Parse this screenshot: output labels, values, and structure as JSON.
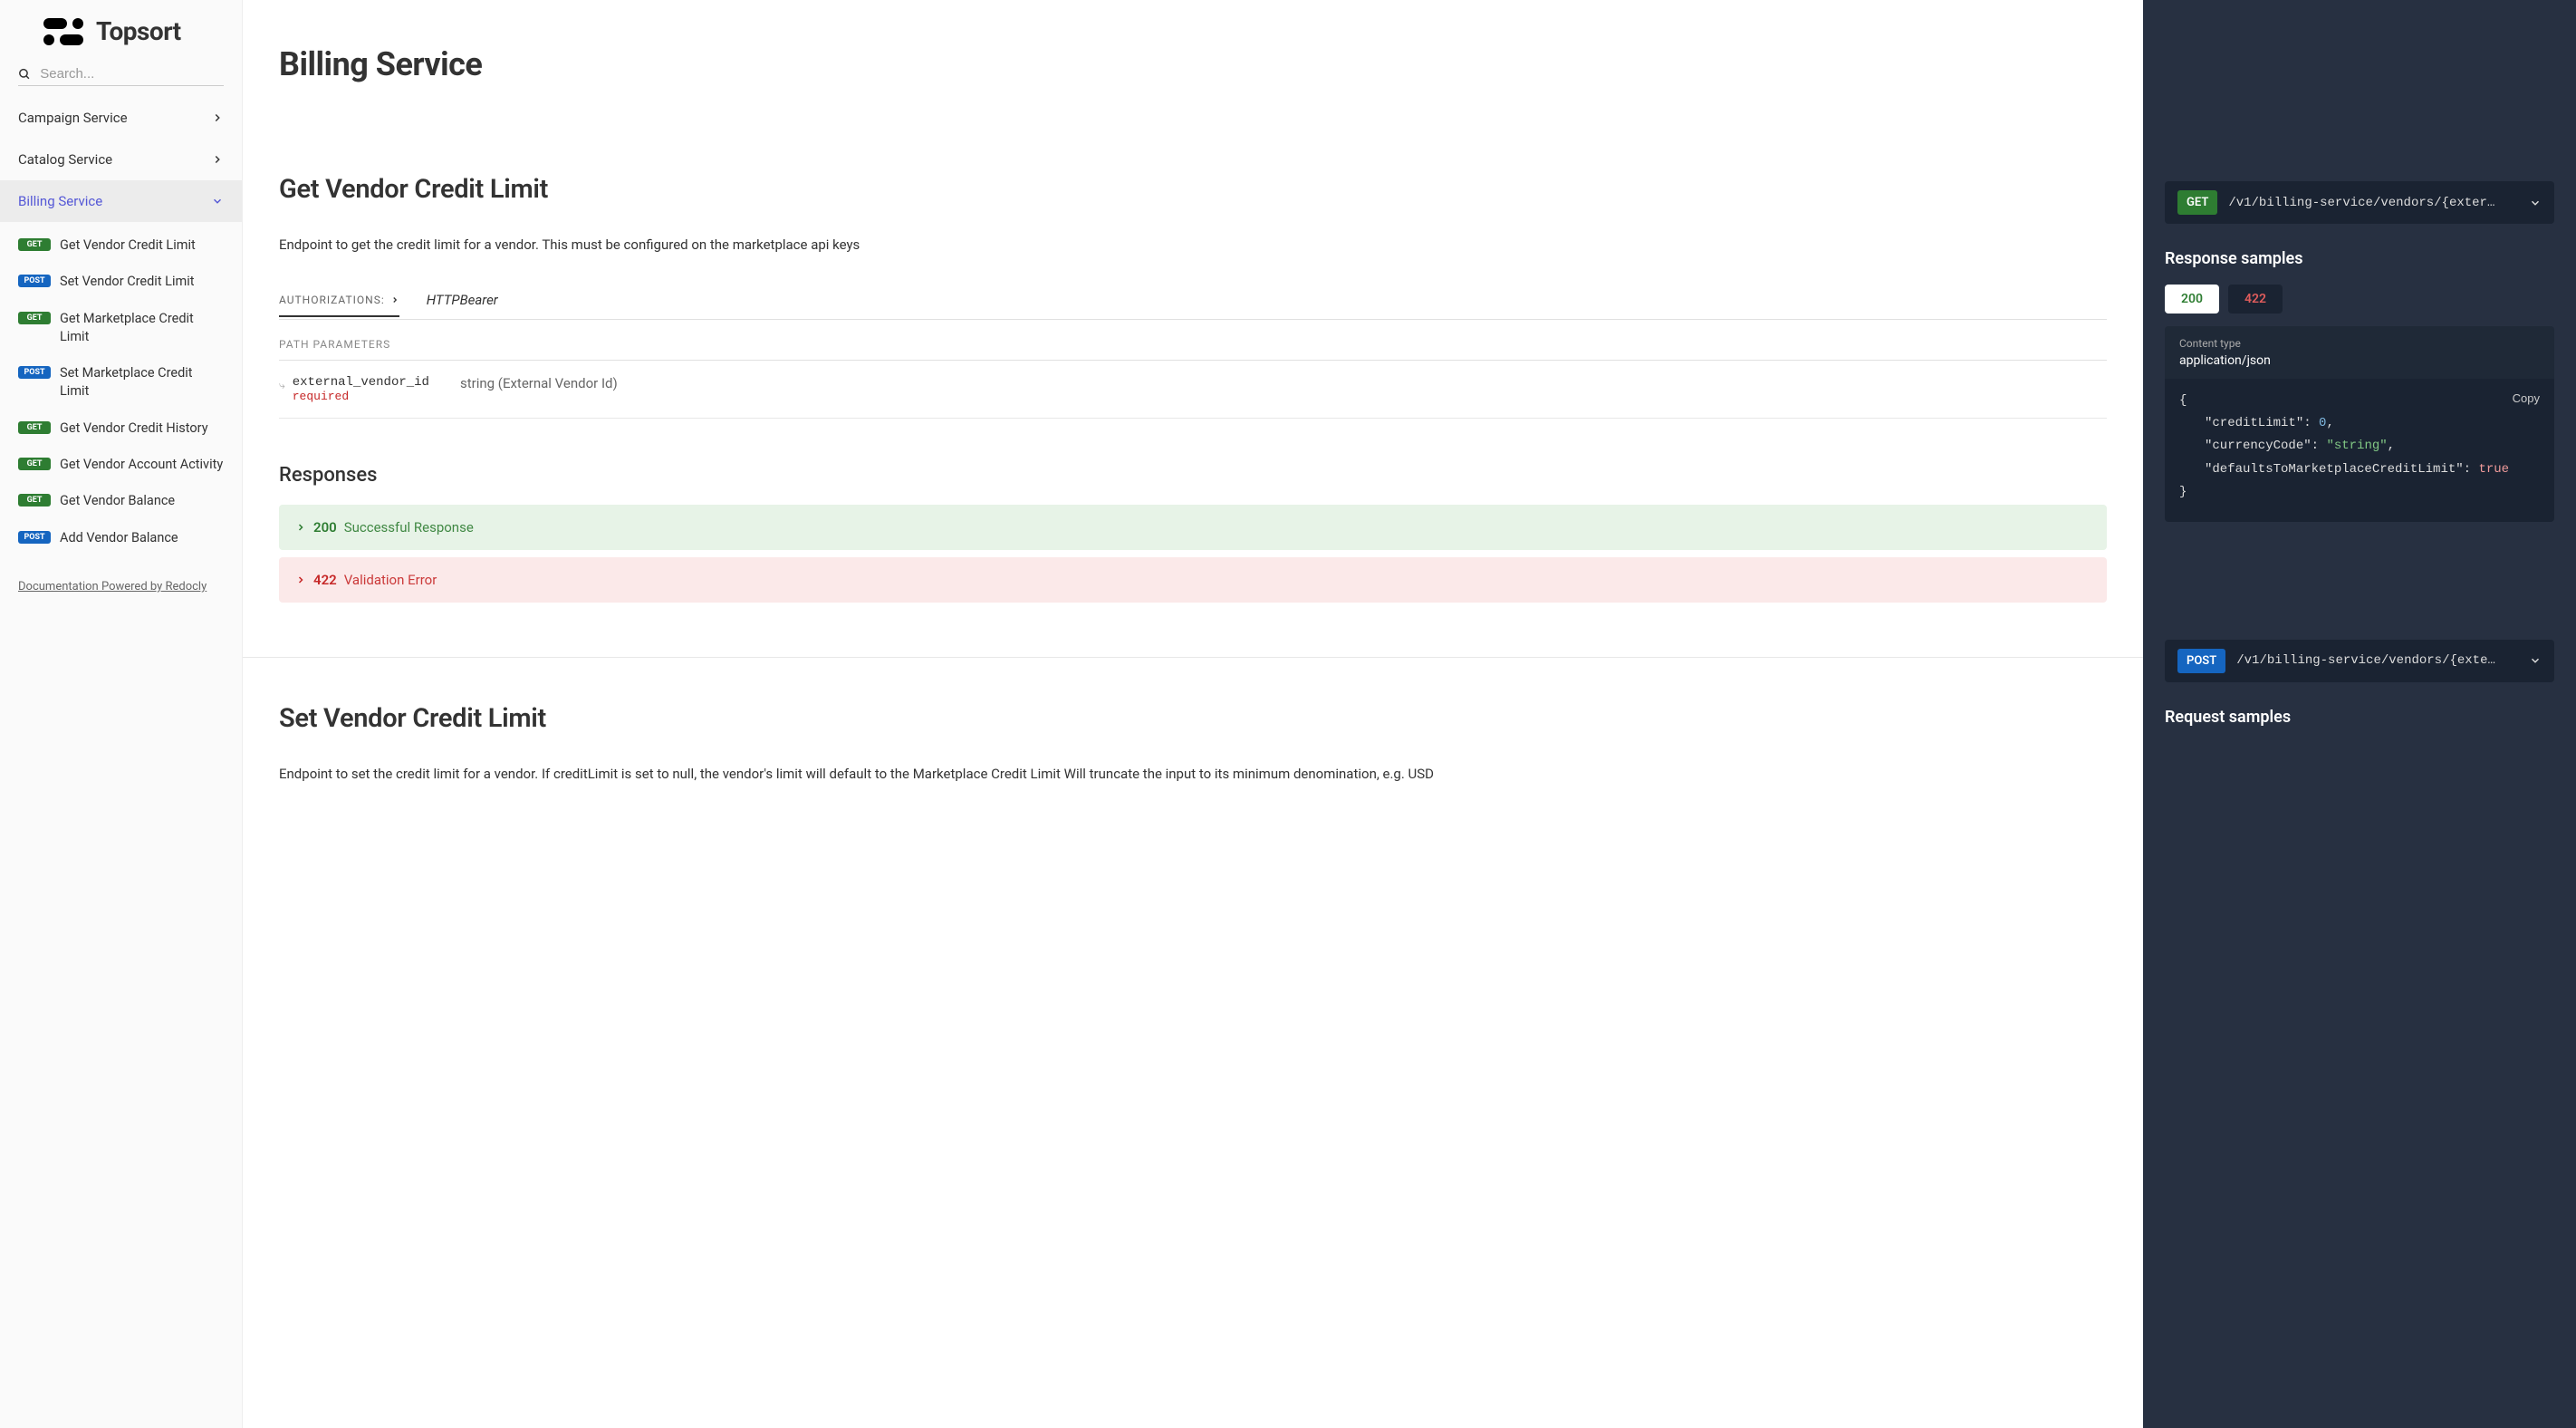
{
  "brand": "Topsort",
  "search": {
    "placeholder": "Search..."
  },
  "nav": {
    "campaign": "Campaign Service",
    "catalog": "Catalog Service",
    "billing": "Billing Service"
  },
  "sub_items": [
    {
      "method": "GET",
      "label": "Get Vendor Credit Limit"
    },
    {
      "method": "POST",
      "label": "Set Vendor Credit Limit"
    },
    {
      "method": "GET",
      "label": "Get Marketplace Credit Limit"
    },
    {
      "method": "POST",
      "label": "Set Marketplace Credit Limit"
    },
    {
      "method": "GET",
      "label": "Get Vendor Credit History"
    },
    {
      "method": "GET",
      "label": "Get Vendor Account Activity"
    },
    {
      "method": "GET",
      "label": "Get Vendor Balance"
    },
    {
      "method": "POST",
      "label": "Add Vendor Balance"
    }
  ],
  "powered": "Documentation Powered by Redocly",
  "service_title": "Billing Service",
  "endpoint1": {
    "title": "Get Vendor Credit Limit",
    "desc": "Endpoint to get the credit limit for a vendor. This must be configured on the marketplace api keys",
    "auth_label": "AUTHORIZATIONS:",
    "auth_scheme": "HTTPBearer",
    "path_params_label": "PATH PARAMETERS",
    "param_name": "external_vendor_id",
    "param_required": "required",
    "param_desc": "string (External Vendor Id)",
    "responses_heading": "Responses",
    "resp200_code": "200",
    "resp200_text": "Successful Response",
    "resp422_code": "422",
    "resp422_text": "Validation Error"
  },
  "endpoint2": {
    "title": "Set Vendor Credit Limit",
    "desc": "Endpoint to set the credit limit for a vendor. If creditLimit is set to null, the vendor's limit will default to the Marketplace Credit Limit Will truncate the input to its minimum denomination, e.g. USD"
  },
  "right": {
    "method1": "GET",
    "url1": "/v1/billing-service/vendors/{exter…",
    "response_samples": "Response samples",
    "tab200": "200",
    "tab422": "422",
    "content_type_label": "Content type",
    "content_type_value": "application/json",
    "copy": "Copy",
    "json": {
      "open": "{",
      "k1": "\"creditLimit\"",
      "v1": "0",
      "k2": "\"currencyCode\"",
      "v2": "\"string\"",
      "k3": "\"defaultsToMarketplaceCreditLimit\"",
      "v3": "true",
      "close": "}"
    },
    "method2": "POST",
    "url2": "/v1/billing-service/vendors/{exte…",
    "request_samples": "Request samples"
  }
}
